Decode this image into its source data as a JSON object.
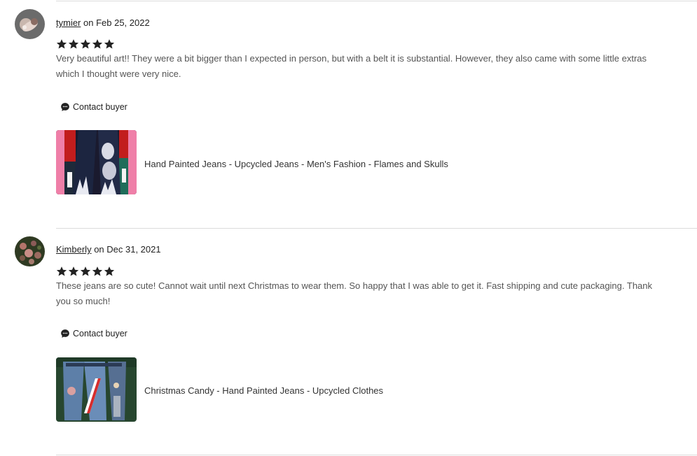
{
  "reviews": [
    {
      "username": "tymier",
      "date_text": " on Feb 25, 2022",
      "rating": 5,
      "text": "Very beautiful art!! They were a bit bigger than I expected in person, but with a belt it is substantial. However, they also came with some little extras which I thought were very nice.",
      "contact_label": "Contact buyer",
      "product_title": "Hand Painted Jeans - Upcycled Jeans - Men's Fashion - Flames and Skulls"
    },
    {
      "username": "Kimberly",
      "date_text": " on Dec 31, 2021",
      "rating": 5,
      "text": "These jeans are so cute! Cannot wait until next Christmas to wear them. So happy that I was able to get it. Fast shipping and cute packaging. Thank you so much!",
      "contact_label": "Contact buyer",
      "product_title": "Christmas Candy - Hand Painted Jeans - Upcycled Clothes"
    }
  ],
  "colors": {
    "star": "#222222",
    "divider": "#dcdcdc",
    "body_text": "#555555"
  }
}
